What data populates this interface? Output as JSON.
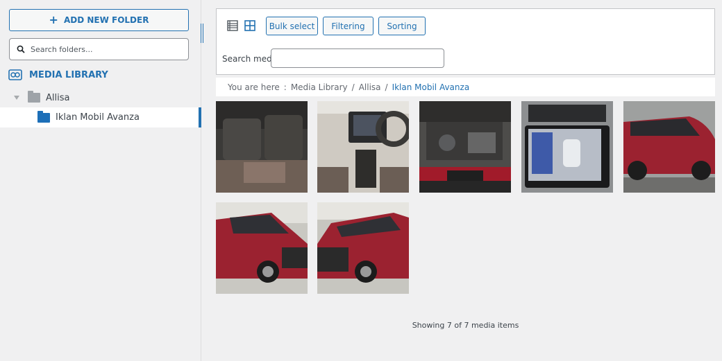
{
  "sidebar": {
    "add_folder_label": "ADD NEW FOLDER",
    "search_placeholder": "Search folders...",
    "library_label": "MEDIA LIBRARY",
    "folders": [
      {
        "label": "Allisa"
      },
      {
        "label": "Iklan Mobil Avanza"
      }
    ]
  },
  "toolbar": {
    "bulk_select": "Bulk select",
    "filtering": "Filtering",
    "sorting": "Sorting",
    "search_label": "Search media",
    "search_value": ""
  },
  "breadcrumb": {
    "prefix": "You are here",
    "sep_colon": ":",
    "items": [
      "Media Library",
      "Allisa",
      "Iklan Mobil Avanza"
    ],
    "sep": "/"
  },
  "media": [
    {
      "name": "car-interior-rear-seats",
      "icon": "photo"
    },
    {
      "name": "car-dashboard",
      "icon": "photo"
    },
    {
      "name": "car-engine-bay",
      "icon": "photo"
    },
    {
      "name": "car-head-unit-screen",
      "icon": "photo"
    },
    {
      "name": "red-car-side",
      "icon": "photo"
    },
    {
      "name": "red-car-front-left",
      "icon": "photo"
    },
    {
      "name": "red-car-front-right",
      "icon": "photo"
    }
  ],
  "status": "Showing 7 of 7 media items",
  "colors": {
    "accent": "#2271b1",
    "car_red": "#9b2230"
  }
}
